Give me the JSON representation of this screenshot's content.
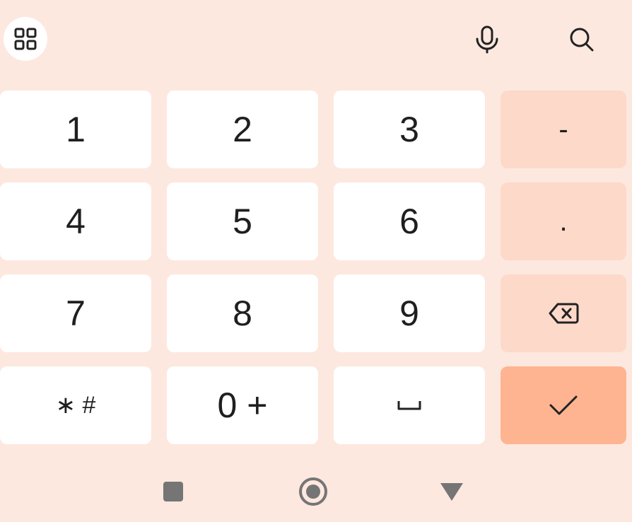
{
  "toolbar": {
    "apps_icon": "grid-icon",
    "mic_icon": "microphone-icon",
    "search_icon": "search-icon"
  },
  "keys": {
    "k1": "1",
    "k2": "2",
    "k3": "3",
    "minus": "-",
    "k4": "4",
    "k5": "5",
    "k6": "6",
    "period": ".",
    "k7": "7",
    "k8": "8",
    "k9": "9",
    "backspace_icon": "backspace-icon",
    "star_hash": "∗ #",
    "zero_plus": "0 +",
    "space_symbol": "␣",
    "enter_icon": "check-icon"
  },
  "navigation": {
    "recent_icon": "square-icon",
    "home_icon": "circle-icon",
    "back_icon": "triangle-down-icon"
  },
  "colors": {
    "background": "#fde8df",
    "key": "#ffffff",
    "side_key": "#fdd9c9",
    "enter_key": "#ffb491",
    "text": "#1f1f1f",
    "nav_icon": "#757575"
  }
}
